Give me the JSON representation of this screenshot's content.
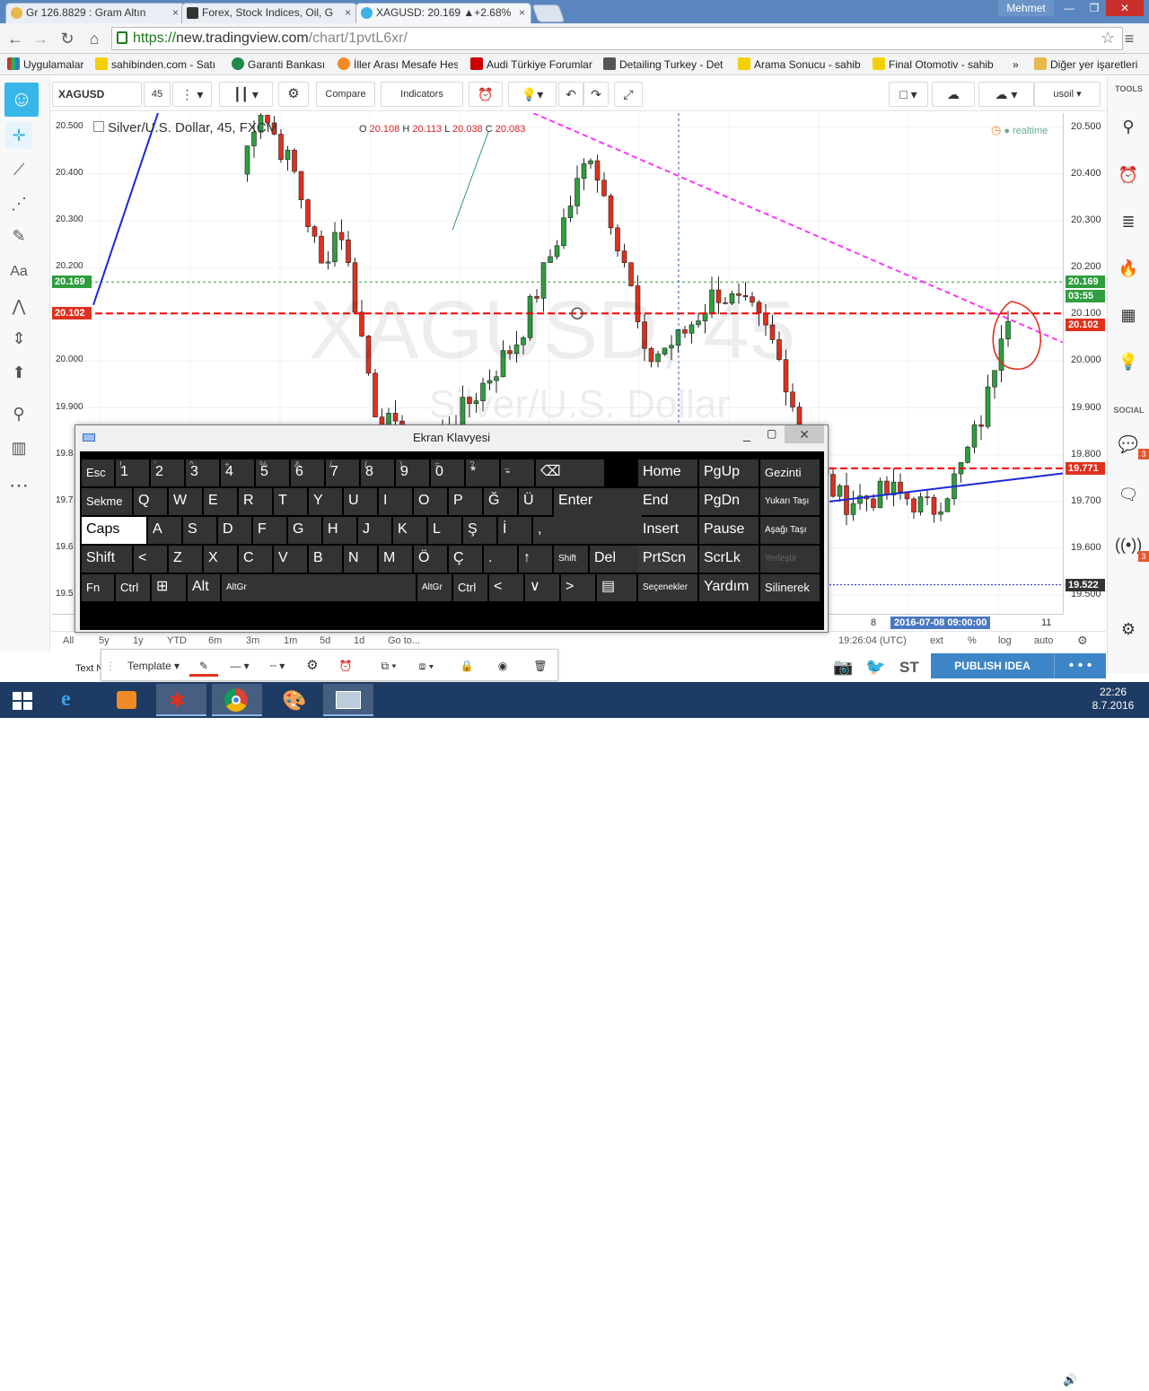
{
  "browser": {
    "tabs": [
      {
        "title": "Gr 126.8829 : Gram Altın",
        "active": false
      },
      {
        "title": "Forex, Stock Indices, Oil, G",
        "active": false
      },
      {
        "title": "XAGUSD: 20.169 ▲+2.68%",
        "active": true
      }
    ],
    "user": "Mehmet",
    "url_scheme": "https://",
    "url_host": "new.tradingview.com",
    "url_path": "/chart/1pvtL6xr/",
    "bookmarks": [
      {
        "label": "Uygulamalar",
        "color": "#c0392b"
      },
      {
        "label": "sahibinden.com - Satı",
        "color": "#f5d000"
      },
      {
        "label": "Garanti Bankası",
        "color": "#1f8a4c"
      },
      {
        "label": "İller Arası Mesafe Hes",
        "color": "#f08a24"
      },
      {
        "label": "Audi Türkiye Forumları",
        "color": "#cc0000"
      },
      {
        "label": "Detailing Turkey - Det",
        "color": "#555555"
      },
      {
        "label": "Arama Sonucu - sahib",
        "color": "#f5d000"
      },
      {
        "label": "Final Otomotiv - sahib",
        "color": "#f5d000"
      },
      {
        "label": "»",
        "color": ""
      },
      {
        "label": "Diğer yer işaretleri",
        "color": "#e8b84a"
      }
    ]
  },
  "toolbar": {
    "symbol": "XAGUSD",
    "interval": "45",
    "compare": "Compare",
    "indicators": "Indicators",
    "account": "usoil"
  },
  "chart": {
    "legend_title": "Silver/U.S. Dollar, 45, FXCM",
    "ohlc": {
      "o_label": "O",
      "o": "20.108",
      "h_label": "H",
      "h": "20.113",
      "l_label": "L",
      "l": "20.038",
      "c_label": "C",
      "c": "20.083"
    },
    "realtime": "realtime",
    "watermark_symbol": "XAGUSD, 45",
    "watermark_desc": "Silver/U.S. Dollar",
    "price_axis": [
      "20.500",
      "20.400",
      "20.300",
      "20.200",
      "20.100",
      "20.000",
      "19.900",
      "19.800",
      "19.700",
      "19.600",
      "19.500"
    ],
    "left_axis": [
      "20.500",
      "20.400",
      "20.300",
      "20.200",
      "20.100",
      "20.000",
      "19.900",
      "19.8",
      "19.7",
      "19.6",
      "19.5"
    ],
    "labels": {
      "current": "20.169",
      "countdown": "03:55",
      "level1": "20.102",
      "level2": "19.771",
      "cross": "19.522"
    },
    "time_axis": {
      "t1": "8",
      "t_cursor": "2016-07-08 09:00:00",
      "t2": "11"
    },
    "status_time": "19:26:04 (UTC)",
    "colors": {
      "up": "#2e9e3f",
      "down": "#e0301e",
      "dashed_red": "#ff0000",
      "magenta": "#ff33ff",
      "blue": "#1a28d8"
    }
  },
  "chart_data": {
    "type": "line",
    "title": "Silver/U.S. Dollar, 45, FXCM",
    "ylim": [
      19.46,
      20.53
    ],
    "x": [],
    "series": [],
    "current_price": 20.169,
    "horizontal_levels": [
      20.169,
      20.102,
      19.771,
      19.522
    ]
  },
  "timebar": {
    "ranges": [
      "All",
      "5y",
      "1y",
      "YTD",
      "6m",
      "3m",
      "1m",
      "5d",
      "1d",
      "Go to..."
    ],
    "right": [
      "ext",
      "%",
      "log",
      "auto"
    ]
  },
  "drawbar": {
    "template": "Template",
    "text_field": "Text N"
  },
  "bottom": {
    "st": "ST",
    "publish": "PUBLISH IDEA",
    "dots": "• • •"
  },
  "right_panel": {
    "tools_label": "TOOLS",
    "social_label": "SOCIAL",
    "badge1": "3",
    "badge2": "3"
  },
  "keyboard": {
    "title": "Ekran Klavyesi",
    "rows": [
      [
        "Esc",
        "1",
        "2",
        "3",
        "4",
        "5",
        "6",
        "7",
        "8",
        "9",
        "0",
        "*",
        "-",
        "⌫"
      ],
      [
        "Sekme",
        "Q",
        "W",
        "E",
        "R",
        "T",
        "Y",
        "U",
        "I",
        "O",
        "P",
        "Ğ",
        "Ü",
        "Enter"
      ],
      [
        "Caps",
        "A",
        "S",
        "D",
        "F",
        "G",
        "H",
        "J",
        "K",
        "L",
        "Ş",
        "İ",
        ","
      ],
      [
        "Shift",
        "<",
        "Z",
        "X",
        "C",
        "V",
        "B",
        "N",
        "M",
        "Ö",
        "Ç",
        ".",
        "↑",
        "Shift",
        "Del"
      ],
      [
        "Fn",
        "Ctrl",
        "⊞",
        "Alt",
        "AltGr",
        "Ctrl",
        "<",
        "∨",
        ">",
        "▤"
      ]
    ],
    "nav": [
      [
        "Home",
        "PgUp",
        "Gezinti"
      ],
      [
        "End",
        "PgDn",
        "Yukarı Taşı"
      ],
      [
        "Insert",
        "Pause",
        "Aşağı Taşı"
      ],
      [
        "PrtScn",
        "ScrLk",
        "Yerleştir"
      ],
      [
        "Seçenekler",
        "Yardım",
        "Silinerek"
      ]
    ],
    "shifted": [
      "é",
      "!",
      "'",
      "^",
      "+",
      "%",
      "&",
      "/",
      "(",
      ")",
      "=",
      "?",
      "_"
    ]
  },
  "taskbar": {
    "time": "22:26",
    "date": "8.7.2016"
  }
}
